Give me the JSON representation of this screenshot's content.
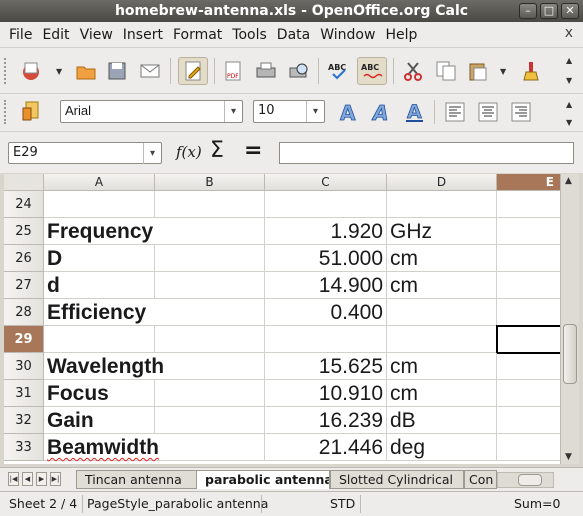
{
  "window": {
    "title": "homebrew-antenna.xls - OpenOffice.org Calc"
  },
  "menu": [
    "File",
    "Edit",
    "View",
    "Insert",
    "Format",
    "Tools",
    "Data",
    "Window",
    "Help"
  ],
  "menu_close": "x",
  "toolbar2": {
    "font_name": "Arial",
    "font_size": "10"
  },
  "formula_bar": {
    "name_box": "E29",
    "fx": "f(x)",
    "sigma": "Σ",
    "equals": "=",
    "content": ""
  },
  "columns": [
    "A",
    "B",
    "C",
    "D",
    "E"
  ],
  "selected_column": "E",
  "rows": [
    {
      "num": "24",
      "label": "",
      "value": "",
      "unit": ""
    },
    {
      "num": "25",
      "label": "Frequency",
      "value": "1.920",
      "unit": "GHz"
    },
    {
      "num": "26",
      "label": "D",
      "value": "51.000",
      "unit": "cm"
    },
    {
      "num": "27",
      "label": "d",
      "value": "14.900",
      "unit": "cm"
    },
    {
      "num": "28",
      "label": "Efficiency",
      "value": "0.400",
      "unit": ""
    },
    {
      "num": "29",
      "label": "",
      "value": "",
      "unit": ""
    },
    {
      "num": "30",
      "label": "Wavelength",
      "value": "15.625",
      "unit": "cm"
    },
    {
      "num": "31",
      "label": "Focus",
      "value": "10.910",
      "unit": "cm"
    },
    {
      "num": "32",
      "label": "Gain",
      "value": "16.239",
      "unit": "dB"
    },
    {
      "num": "33",
      "label": "Beamwidth",
      "value": "21.446",
      "unit": "deg"
    }
  ],
  "selected_row": "29",
  "sheet_tabs": [
    "Tincan antenna",
    "parabolic antenna",
    "Slotted Cylindrical",
    "Con"
  ],
  "active_sheet": "parabolic antenna",
  "status": {
    "sheet": "Sheet 2 / 4",
    "page_style": "PageStyle_parabolic antenna",
    "mode": "STD",
    "sum": "Sum=0"
  }
}
